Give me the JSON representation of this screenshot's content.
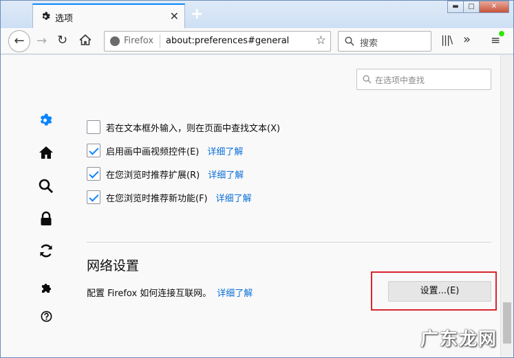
{
  "tab": {
    "title": "选项",
    "icon": "gear-icon",
    "close_label": "✕"
  },
  "newtab_label": "+",
  "window_buttons": {
    "minimize": "▬",
    "maximize": "□",
    "close": "✕"
  },
  "nav": {
    "back_label": "←",
    "forward_label": "→",
    "reload_label": "↻",
    "url_identity": "Firefox",
    "url": "about:preferences#general",
    "bookmark_star": "☆",
    "search_placeholder": "搜索",
    "library_label": "|||\\",
    "overflow_label": "»",
    "menu_label": "≡"
  },
  "prefs": {
    "search_placeholder": "在选项中查找",
    "checkboxes": [
      {
        "label": "若在文本框外输入，则在页面中查找文本(X)",
        "checked": false,
        "learn_more": ""
      },
      {
        "label": "启用画中画视频控件(E)",
        "checked": true,
        "learn_more": "详细了解"
      },
      {
        "label": "在您浏览时推荐扩展(R)",
        "checked": true,
        "learn_more": "详细了解"
      },
      {
        "label": "在您浏览时推荐新功能(F)",
        "checked": true,
        "learn_more": "详细了解"
      }
    ],
    "network": {
      "title": "网络设置",
      "description": "配置 Firefox 如何连接互联网。",
      "learn_more": "详细了解",
      "settings_button": "设置...(E)"
    }
  },
  "sidebar": [
    "gear-icon",
    "home-icon",
    "search-icon",
    "lock-icon",
    "sync-icon",
    "puzzle-icon",
    "help-icon"
  ],
  "watermark": "广东龙网",
  "colors": {
    "accent": "#0a84ff",
    "link": "#0a6fd6",
    "highlight": "#d9242b"
  }
}
